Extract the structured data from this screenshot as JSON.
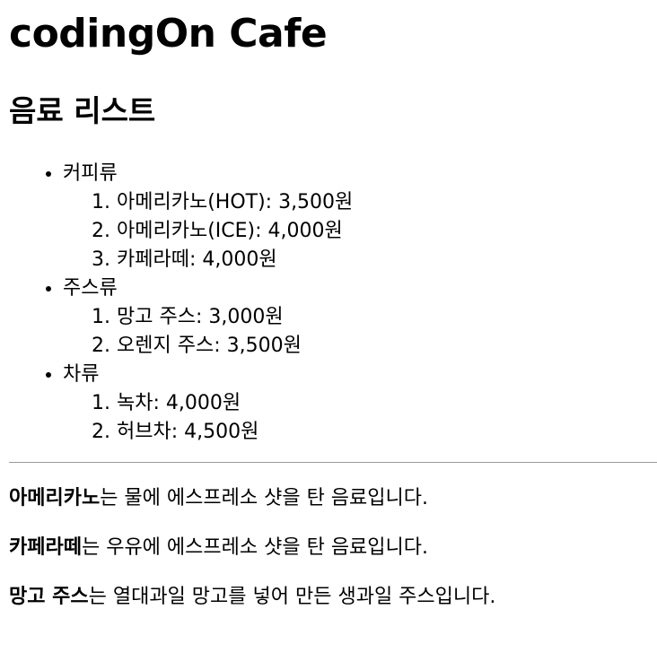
{
  "title": "codingOn Cafe",
  "subtitle": "음료 리스트",
  "categories": [
    {
      "name": "커피류",
      "items": [
        "아메리카노(HOT): 3,500원",
        "아메리카노(ICE): 4,000원",
        "카페라떼: 4,000원"
      ]
    },
    {
      "name": "주스류",
      "items": [
        "망고 주스: 3,000원",
        "오렌지 주스: 3,500원"
      ]
    },
    {
      "name": "차류",
      "items": [
        "녹차: 4,000원",
        "허브차: 4,500원"
      ]
    }
  ],
  "descriptions": [
    {
      "term": "아메리카노",
      "text": "는 물에 에스프레소 샷을 탄 음료입니다."
    },
    {
      "term": "카페라떼",
      "text": "는 우유에 에스프레소 샷을 탄 음료입니다."
    },
    {
      "term": "망고 주스",
      "text": "는 열대과일 망고를 넣어 만든 생과일 주스입니다."
    }
  ]
}
